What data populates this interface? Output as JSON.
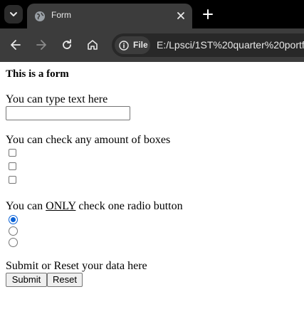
{
  "browser": {
    "tab_title": "Form",
    "site_chip_label": "File",
    "url": "E:/Lpsci/1ST%20quarter%20portfo"
  },
  "form": {
    "heading": "This is a form",
    "text_section_label": "You can type text here",
    "text_input_value": "",
    "checkbox_section_label": "You can check any amount of boxes",
    "checkboxes": [
      false,
      false,
      false
    ],
    "radio_section_label_before": "You can ",
    "radio_section_label_emphasis": "ONLY",
    "radio_section_label_after": " check one radio button",
    "radios": [
      true,
      false,
      false
    ],
    "buttons_section_label": "Submit or Reset your data here",
    "submit_label": "Submit",
    "reset_label": "Reset"
  },
  "colors": {
    "chrome_bg": "#000000",
    "toolbar_bg": "#3c3c3c",
    "radio_checked": "#0b62d6"
  }
}
